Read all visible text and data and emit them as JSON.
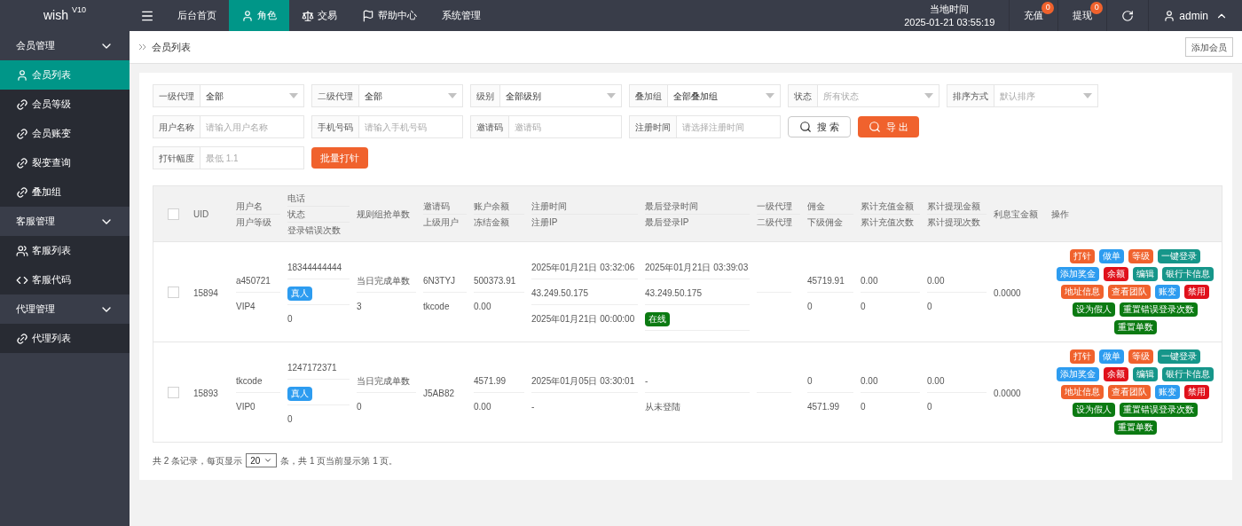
{
  "brand": {
    "name": "wish",
    "version": "V10"
  },
  "top_nav": [
    {
      "label": "后台首页",
      "selected": false
    },
    {
      "label": "角色",
      "selected": true
    },
    {
      "label": "交易",
      "selected": false
    },
    {
      "label": "帮助中心",
      "selected": false
    },
    {
      "label": "系统管理",
      "selected": false
    }
  ],
  "clock": {
    "label": "当地时间",
    "value": "2025-01-21 03:55:19"
  },
  "top_actions": [
    {
      "label": "充值",
      "badge": "0"
    },
    {
      "label": "提现",
      "badge": "0"
    }
  ],
  "user": {
    "name": "admin"
  },
  "sidebar": [
    {
      "label": "会员管理",
      "expanded": true,
      "items": [
        {
          "label": "会员列表",
          "selected": true
        },
        {
          "label": "会员等级",
          "selected": false
        },
        {
          "label": "会员账变",
          "selected": false
        },
        {
          "label": "裂变查询",
          "selected": false
        },
        {
          "label": "叠加组",
          "selected": false
        }
      ]
    },
    {
      "label": "客服管理",
      "expanded": true,
      "items": [
        {
          "label": "客服列表",
          "selected": false
        },
        {
          "label": "客服代码",
          "selected": false
        }
      ]
    },
    {
      "label": "代理管理",
      "expanded": true,
      "items": [
        {
          "label": "代理列表",
          "selected": false
        }
      ]
    }
  ],
  "breadcrumb": "会员列表",
  "add_button": "添加会员",
  "filters": [
    [
      {
        "kind": "select",
        "label": "一级代理",
        "value": "全部"
      },
      {
        "kind": "select",
        "label": "二级代理",
        "value": "全部"
      },
      {
        "kind": "select",
        "label": "级别",
        "value": "全部级别"
      },
      {
        "kind": "select",
        "label": "叠加组",
        "value": "全部叠加组"
      },
      {
        "kind": "select",
        "label": "状态",
        "placeholder": "所有状态"
      },
      {
        "kind": "select",
        "label": "排序方式",
        "placeholder": "默认排序"
      }
    ],
    [
      {
        "kind": "input",
        "label": "用户名称",
        "placeholder": "请输入用户名称"
      },
      {
        "kind": "input",
        "label": "手机号码",
        "placeholder": "请输入手机号码"
      },
      {
        "kind": "input",
        "label": "邀请码",
        "placeholder": "邀请码"
      },
      {
        "kind": "input",
        "label": "注册时间",
        "placeholder": "请选择注册时间"
      },
      {
        "kind": "search",
        "label": "搜 索"
      },
      {
        "kind": "export",
        "label": "导 出"
      }
    ],
    [
      {
        "kind": "input",
        "label": "打针幅度",
        "placeholder": "最低 1.1"
      },
      {
        "kind": "batch",
        "label": "批量打针"
      }
    ]
  ],
  "table": {
    "columns": [
      {
        "kind": "checkbox",
        "checked": false
      },
      {
        "kind": "text",
        "lines": [
          "UID"
        ]
      },
      {
        "kind": "text",
        "lines": [
          "用户名",
          "用户等级"
        ]
      },
      {
        "kind": "text",
        "lines": [
          "电话",
          "状态",
          "登录错误次数"
        ]
      },
      {
        "kind": "text",
        "lines": [
          "规则组抢单数"
        ]
      },
      {
        "kind": "text",
        "lines": [
          "邀请码",
          "上级用户"
        ]
      },
      {
        "kind": "text",
        "lines": [
          "账户余额",
          "冻结金额"
        ]
      },
      {
        "kind": "text",
        "lines": [
          "注册时间",
          "注册IP"
        ]
      },
      {
        "kind": "text",
        "lines": [
          "最后登录时间",
          "最后登录IP"
        ]
      },
      {
        "kind": "text",
        "lines": [
          "一级代理",
          "二级代理"
        ]
      },
      {
        "kind": "text",
        "lines": [
          "佣金",
          "下级佣金"
        ]
      },
      {
        "kind": "text",
        "lines": [
          "累计充值金额",
          "累计充值次数"
        ]
      },
      {
        "kind": "text",
        "lines": [
          "累计提现金额",
          "累计提现次数"
        ]
      },
      {
        "kind": "text",
        "lines": [
          "利息宝金额"
        ]
      },
      {
        "kind": "text",
        "lines": [
          "操作"
        ]
      }
    ],
    "rows": [
      {
        "cells": [
          {
            "kind": "checkbox",
            "checked": false
          },
          {
            "kind": "stack",
            "items": [
              {
                "kind": "text",
                "text": "15894"
              }
            ]
          },
          {
            "kind": "stack",
            "items": [
              {
                "kind": "text",
                "text": "a450721"
              },
              {
                "kind": "text",
                "text": "VIP4"
              }
            ]
          },
          {
            "kind": "stack",
            "items": [
              {
                "kind": "text",
                "text": "18344444444"
              },
              {
                "kind": "badge",
                "text": "真人",
                "color": "#2d9cf0"
              },
              {
                "kind": "text",
                "text": "0"
              }
            ]
          },
          {
            "kind": "stack",
            "items": [
              {
                "kind": "text",
                "text": "当日完成单数"
              },
              {
                "kind": "text",
                "text": "3"
              }
            ]
          },
          {
            "kind": "stack",
            "items": [
              {
                "kind": "text",
                "text": "6N3TYJ"
              },
              {
                "kind": "text",
                "text": "tkcode"
              }
            ]
          },
          {
            "kind": "stack",
            "items": [
              {
                "kind": "text",
                "text": "500373.91"
              },
              {
                "kind": "text",
                "text": "0.00"
              }
            ]
          },
          {
            "kind": "stack",
            "items": [
              {
                "kind": "text",
                "text": "2025年01月21日 03:32:06"
              },
              {
                "kind": "text",
                "text": "43.249.50.175"
              },
              {
                "kind": "text",
                "text": "2025年01月21日 00:00:00"
              }
            ]
          },
          {
            "kind": "stack",
            "items": [
              {
                "kind": "text",
                "text": "2025年01月21日 03:39:03"
              },
              {
                "kind": "text",
                "text": "43.249.50.175"
              },
              {
                "kind": "badge",
                "text": "在线",
                "color": "#0b7a12"
              }
            ]
          },
          {
            "kind": "blank"
          },
          {
            "kind": "stack",
            "items": [
              {
                "kind": "text",
                "text": "45719.91"
              },
              {
                "kind": "text",
                "text": "0"
              }
            ]
          },
          {
            "kind": "stack",
            "items": [
              {
                "kind": "text",
                "text": "0.00"
              },
              {
                "kind": "text",
                "text": "0"
              }
            ]
          },
          {
            "kind": "stack",
            "items": [
              {
                "kind": "text",
                "text": "0.00"
              },
              {
                "kind": "text",
                "text": "0"
              }
            ]
          },
          {
            "kind": "stack",
            "items": [
              {
                "kind": "text",
                "text": "0.0000"
              }
            ]
          },
          {
            "kind": "actions",
            "buttons": [
              {
                "label": "打针",
                "color": "#f0622d"
              },
              {
                "label": "做单",
                "color": "#2d9cf0"
              },
              {
                "label": "等级",
                "color": "#f0622d"
              },
              {
                "label": "一键登录",
                "color": "#16968a"
              },
              {
                "label": "添加奖金",
                "color": "#2d9cf0"
              },
              {
                "label": "余额",
                "color": "#e0111b"
              },
              {
                "label": "编辑",
                "color": "#16968a"
              },
              {
                "label": "银行卡信息",
                "color": "#16968a"
              },
              {
                "label": "地址信息",
                "color": "#f0622d"
              },
              {
                "label": "查看团队",
                "color": "#f0622d"
              },
              {
                "label": "账变",
                "color": "#2d9cf0"
              },
              {
                "label": "禁用",
                "color": "#e0111b"
              },
              {
                "label": "设为假人",
                "color": "#0b7a12"
              },
              {
                "label": "重置错误登录次数",
                "color": "#0b7a12"
              },
              {
                "label": "重置单数",
                "color": "#0b7a12"
              }
            ]
          }
        ]
      },
      {
        "cells": [
          {
            "kind": "checkbox",
            "checked": false
          },
          {
            "kind": "stack",
            "items": [
              {
                "kind": "text",
                "text": "15893"
              }
            ]
          },
          {
            "kind": "stack",
            "items": [
              {
                "kind": "text",
                "text": "tkcode"
              },
              {
                "kind": "text",
                "text": "VIP0"
              }
            ]
          },
          {
            "kind": "stack",
            "items": [
              {
                "kind": "text",
                "text": "1247172371"
              },
              {
                "kind": "badge",
                "text": "真人",
                "color": "#2d9cf0"
              },
              {
                "kind": "text",
                "text": "0"
              }
            ]
          },
          {
            "kind": "stack",
            "items": [
              {
                "kind": "text",
                "text": "当日完成单数"
              },
              {
                "kind": "text",
                "text": "0"
              }
            ]
          },
          {
            "kind": "stack",
            "items": [
              {
                "kind": "text",
                "text": "J5AB82"
              }
            ]
          },
          {
            "kind": "stack",
            "items": [
              {
                "kind": "text",
                "text": "4571.99"
              },
              {
                "kind": "text",
                "text": "0.00"
              }
            ]
          },
          {
            "kind": "stack",
            "items": [
              {
                "kind": "text",
                "text": "2025年01月05日 03:30:01"
              },
              {
                "kind": "text",
                "text": "-"
              }
            ]
          },
          {
            "kind": "stack",
            "items": [
              {
                "kind": "text",
                "text": "-"
              },
              {
                "kind": "text",
                "text": "从未登陆"
              }
            ]
          },
          {
            "kind": "blank"
          },
          {
            "kind": "stack",
            "items": [
              {
                "kind": "text",
                "text": "0"
              },
              {
                "kind": "text",
                "text": "4571.99"
              }
            ]
          },
          {
            "kind": "stack",
            "items": [
              {
                "kind": "text",
                "text": "0.00"
              },
              {
                "kind": "text",
                "text": "0"
              }
            ]
          },
          {
            "kind": "stack",
            "items": [
              {
                "kind": "text",
                "text": "0.00"
              },
              {
                "kind": "text",
                "text": "0"
              }
            ]
          },
          {
            "kind": "stack",
            "items": [
              {
                "kind": "text",
                "text": "0.0000"
              }
            ]
          },
          {
            "kind": "actions",
            "buttons": [
              {
                "label": "打针",
                "color": "#f0622d"
              },
              {
                "label": "做单",
                "color": "#2d9cf0"
              },
              {
                "label": "等级",
                "color": "#f0622d"
              },
              {
                "label": "一键登录",
                "color": "#16968a"
              },
              {
                "label": "添加奖金",
                "color": "#2d9cf0"
              },
              {
                "label": "余额",
                "color": "#e0111b"
              },
              {
                "label": "编辑",
                "color": "#16968a"
              },
              {
                "label": "银行卡信息",
                "color": "#16968a"
              },
              {
                "label": "地址信息",
                "color": "#f0622d"
              },
              {
                "label": "查看团队",
                "color": "#f0622d"
              },
              {
                "label": "账变",
                "color": "#2d9cf0"
              },
              {
                "label": "禁用",
                "color": "#e0111b"
              },
              {
                "label": "设为假人",
                "color": "#0b7a12"
              },
              {
                "label": "重置错误登录次数",
                "color": "#0b7a12"
              },
              {
                "label": "重置单数",
                "color": "#0b7a12"
              }
            ]
          }
        ]
      }
    ]
  },
  "pagination": {
    "before": "共 2 条记录，每页显示",
    "page_size": "20",
    "after": "条，共 1 页当前显示第 1 页。"
  }
}
